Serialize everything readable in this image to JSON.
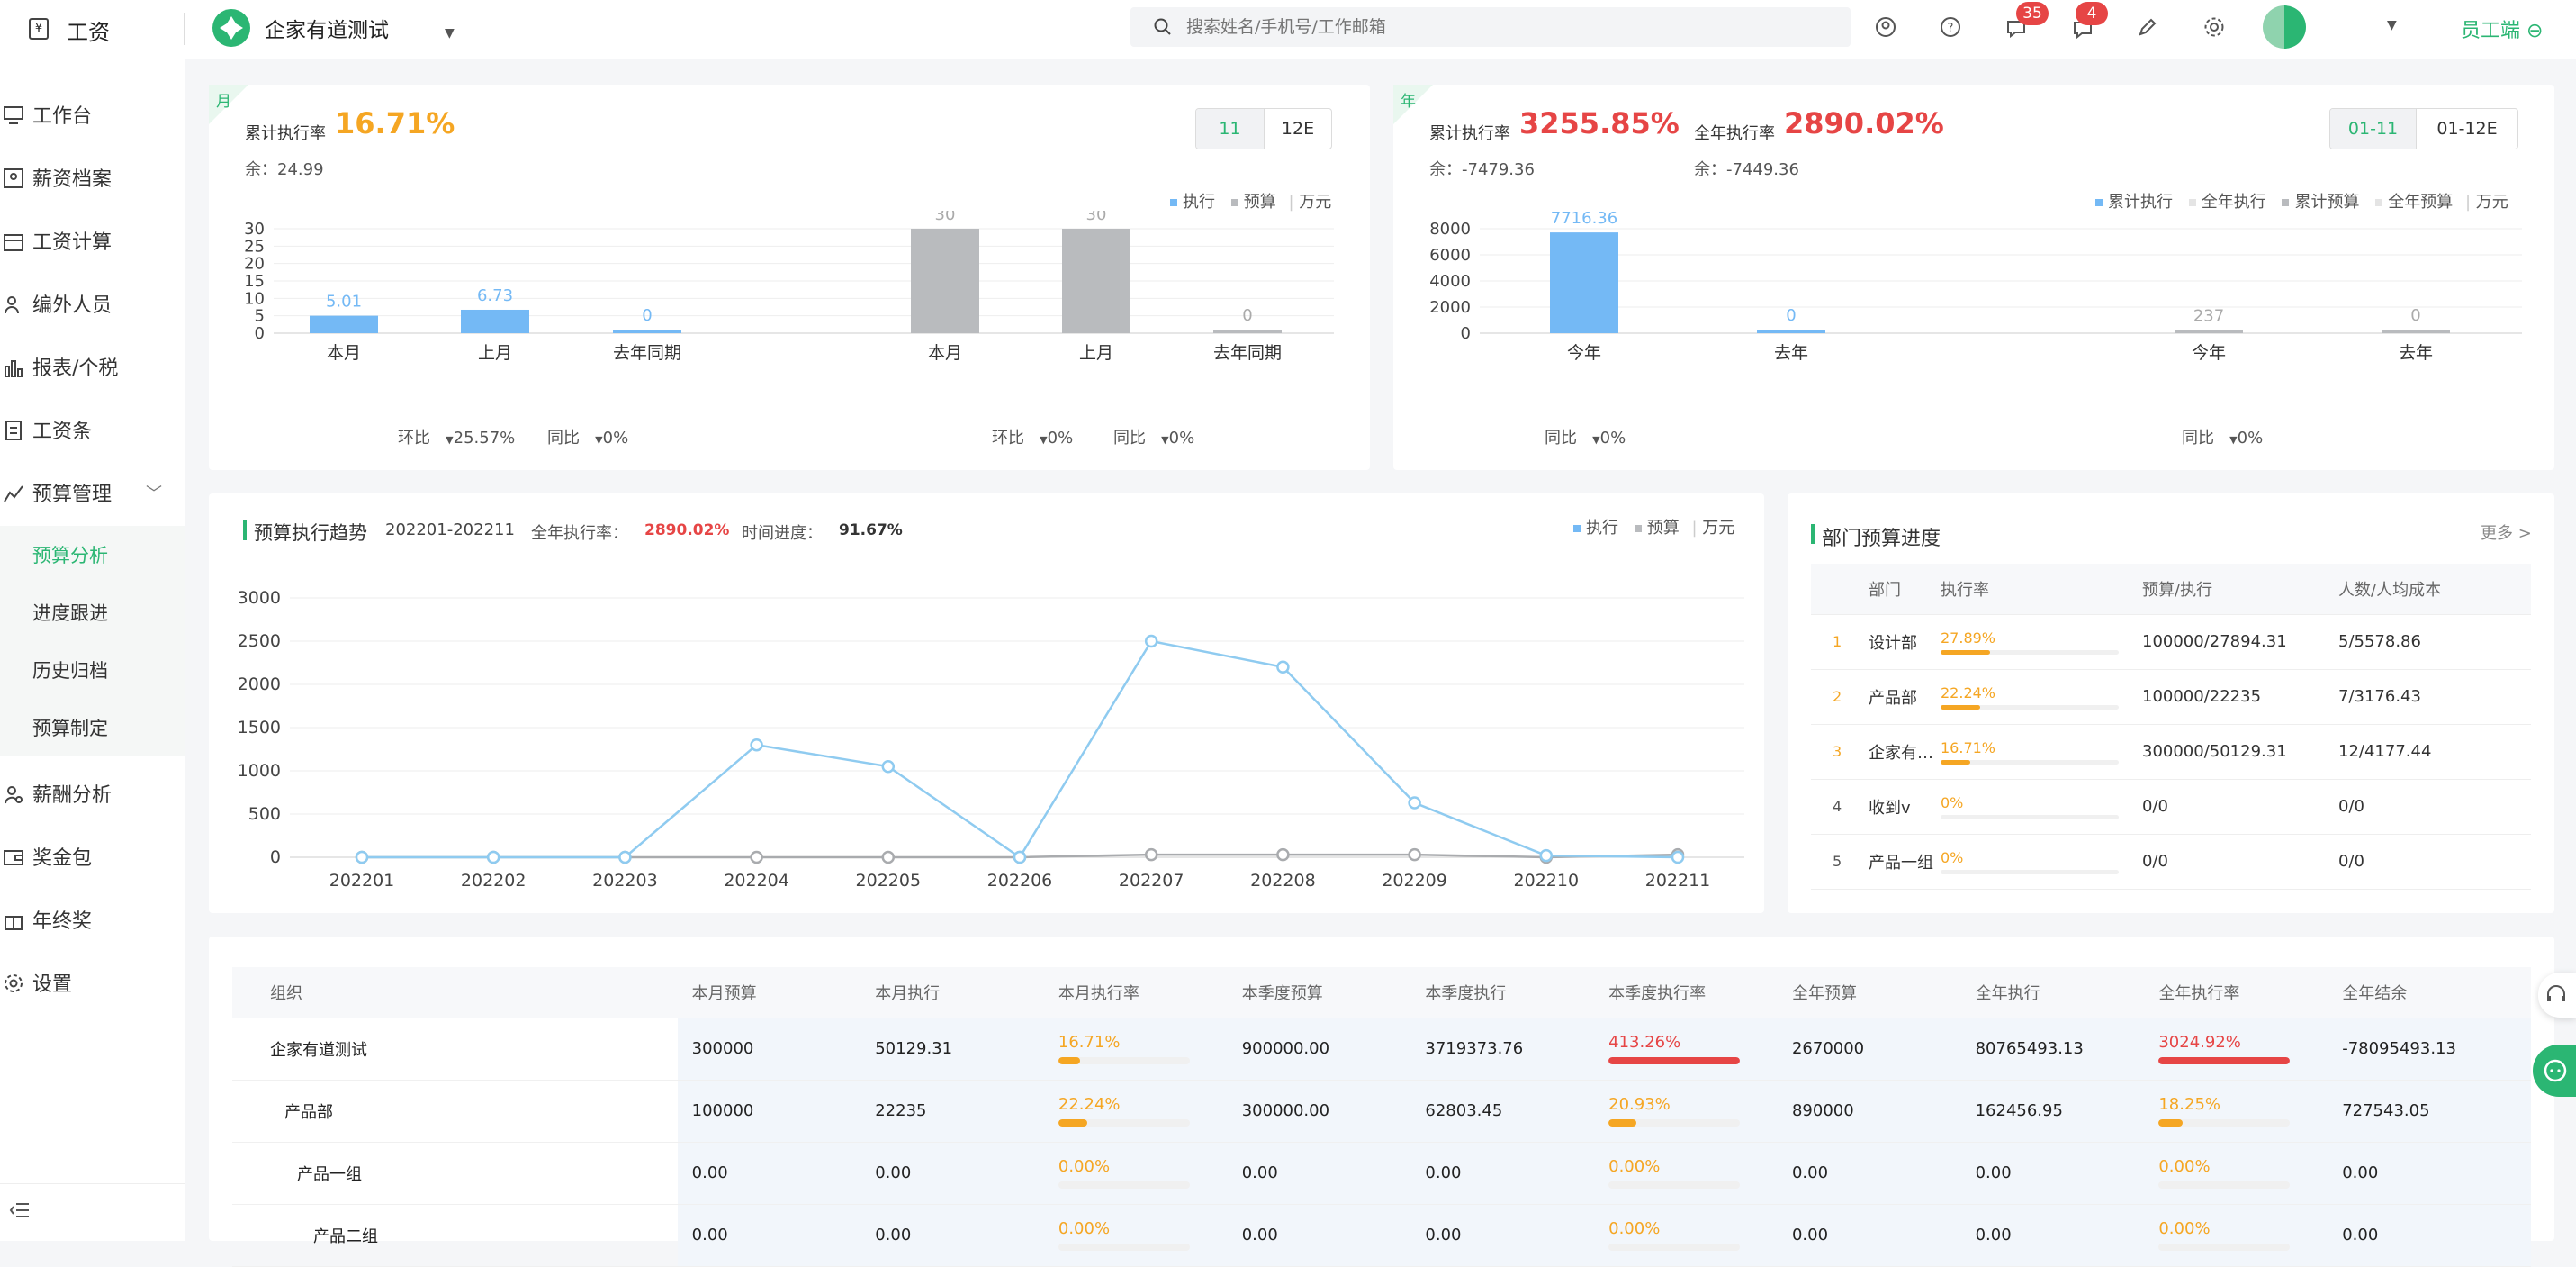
{
  "app": {
    "logo_text": "工资",
    "company": "企家有道测试",
    "search_placeholder": "搜索姓名/手机号/工作邮箱",
    "notif_count": "35",
    "msg_count": "4",
    "employee_side": "员工端"
  },
  "sidebar": {
    "items": [
      {
        "label": "工作台",
        "icon": "monitor-icon"
      },
      {
        "label": "薪资档案",
        "icon": "person-card-icon"
      },
      {
        "label": "工资计算",
        "icon": "calendar-icon"
      },
      {
        "label": "编外人员",
        "icon": "person-add-icon"
      },
      {
        "label": "报表/个税",
        "icon": "bar-chart-icon"
      },
      {
        "label": "工资条",
        "icon": "document-icon"
      },
      {
        "label": "预算管理",
        "icon": "trend-icon"
      },
      {
        "label": "预算分析"
      },
      {
        "label": "进度跟进"
      },
      {
        "label": "历史归档"
      },
      {
        "label": "预算制定"
      },
      {
        "label": "薪酬分析",
        "icon": "person-search-icon"
      },
      {
        "label": "奖金包",
        "icon": "wallet-icon"
      },
      {
        "label": "年终奖",
        "icon": "gift-icon"
      },
      {
        "label": "设置",
        "icon": "gear-icon"
      }
    ]
  },
  "month_card": {
    "tag": "月",
    "rate_label": "累计执行率",
    "rate": "16.71%",
    "remain": "余：24.99",
    "seg": [
      "11",
      "12E"
    ],
    "legend": {
      "exec": "执行",
      "budget": "预算",
      "unit": "万元"
    },
    "compare": {
      "hb_label": "环比",
      "hb_value": "25.57%",
      "tb_label": "同比",
      "tb_value": "0%",
      "hb2_label": "环比",
      "hb2_value": "0%",
      "tb2_label": "同比",
      "tb2_value": "0%"
    }
  },
  "year_card": {
    "tag": "年",
    "rate1_label": "累计执行率",
    "rate1": "3255.85%",
    "remain1": "余：-7479.36",
    "rate2_label": "全年执行率",
    "rate2": "2890.02%",
    "remain2": "余：-7449.36",
    "seg": [
      "01-11",
      "01-12E"
    ],
    "legend": {
      "l1": "累计执行",
      "l2": "全年执行",
      "l3": "累计预算",
      "l4": "全年预算",
      "unit": "万元"
    },
    "compare": {
      "tb_label": "同比",
      "tb_value": "0%",
      "tb2_label": "同比",
      "tb2_value": "0%"
    }
  },
  "trend_card": {
    "title": "预算执行趋势",
    "range": "202201-202211",
    "rate_label": "全年执行率：",
    "rate": "2890.02%",
    "progress_label": "时间进度：",
    "progress": "91.67%",
    "legend": {
      "exec": "执行",
      "budget": "预算",
      "unit": "万元"
    }
  },
  "dept_card": {
    "title": "部门预算进度",
    "more": "更多 >",
    "headers": [
      "部门",
      "执行率",
      "预算/执行",
      "人数/人均成本"
    ],
    "rows": [
      {
        "idx": "1",
        "name": "设计部",
        "rate": "27.89%",
        "fill": 0.2789,
        "budget": "100000/27894.31",
        "people": "5/5578.86"
      },
      {
        "idx": "2",
        "name": "产品部",
        "rate": "22.24%",
        "fill": 0.2224,
        "budget": "100000/22235",
        "people": "7/3176.43"
      },
      {
        "idx": "3",
        "name": "企家有…",
        "rate": "16.71%",
        "fill": 0.1671,
        "budget": "300000/50129.31",
        "people": "12/4177.44"
      },
      {
        "idx": "4",
        "name": "收到v",
        "rate": "0%",
        "fill": 0.0,
        "budget": "0/0",
        "people": "0/0"
      },
      {
        "idx": "5",
        "name": "产品一组",
        "rate": "0%",
        "fill": 0.0,
        "budget": "0/0",
        "people": "0/0"
      }
    ]
  },
  "org_table": {
    "headers": [
      "组织",
      "本月预算",
      "本月执行",
      "本月执行率",
      "本季度预算",
      "本季度执行",
      "本季度执行率",
      "全年预算",
      "全年执行",
      "全年执行率",
      "全年结余"
    ],
    "rows": [
      {
        "org": "企家有道测试",
        "mb": "300000",
        "me": "50129.31",
        "mr": "16.71%",
        "mr_fill": 0.1671,
        "mr_color": "#f5a623",
        "qb": "900000.00",
        "qe": "3719373.76",
        "qr": "413.26%",
        "qr_fill": 1.0,
        "qr_color": "#e64545",
        "yb": "2670000",
        "ye": "80765493.13",
        "yr": "3024.92%",
        "yr_fill": 1.0,
        "yr_color": "#e64545",
        "ys": "-78095493.13"
      },
      {
        "org": "产品部",
        "mb": "100000",
        "me": "22235",
        "mr": "22.24%",
        "mr_fill": 0.2224,
        "mr_color": "#f5a623",
        "qb": "300000.00",
        "qe": "62803.45",
        "qr": "20.93%",
        "qr_fill": 0.2093,
        "qr_color": "#f5a623",
        "yb": "890000",
        "ye": "162456.95",
        "yr": "18.25%",
        "yr_fill": 0.1825,
        "yr_color": "#f5a623",
        "ys": "727543.05"
      },
      {
        "org": "产品一组",
        "mb": "0.00",
        "me": "0.00",
        "mr": "0.00%",
        "mr_fill": 0.0,
        "mr_color": "#f5a623",
        "qb": "0.00",
        "qe": "0.00",
        "qr": "0.00%",
        "qr_fill": 0.0,
        "qr_color": "#f5a623",
        "yb": "0.00",
        "ye": "0.00",
        "yr": "0.00%",
        "yr_fill": 0.0,
        "yr_color": "#f5a623",
        "ys": "0.00"
      },
      {
        "org": "产品二组",
        "mb": "0.00",
        "me": "0.00",
        "mr": "0.00%",
        "mr_fill": 0.0,
        "mr_color": "#f5a623",
        "qb": "0.00",
        "qe": "0.00",
        "qr": "0.00%",
        "qr_fill": 0.0,
        "qr_color": "#f5a623",
        "yb": "0.00",
        "ye": "0.00",
        "yr": "0.00%",
        "yr_fill": 0.0,
        "yr_color": "#f5a623",
        "ys": "0.00"
      }
    ]
  },
  "chart_data": [
    {
      "type": "bar",
      "name": "month-exec",
      "categories": [
        "本月",
        "上月",
        "去年同期"
      ],
      "values": [
        5.01,
        6.73,
        0
      ],
      "ylim": [
        0,
        30
      ],
      "yticks": [
        0,
        5,
        10,
        15,
        20,
        25,
        30
      ],
      "color": "#74b9f5"
    },
    {
      "type": "bar",
      "name": "month-budget",
      "categories": [
        "本月",
        "上月",
        "去年同期"
      ],
      "values": [
        30,
        30,
        0
      ],
      "ylim": [
        0,
        30
      ],
      "color": "#b9bbbe"
    },
    {
      "type": "bar",
      "name": "year-exec",
      "categories": [
        "今年",
        "去年"
      ],
      "values": [
        7716.36,
        0
      ],
      "ylim": [
        0,
        8000
      ],
      "yticks": [
        0,
        2000,
        4000,
        6000,
        8000
      ],
      "color": "#74b9f5"
    },
    {
      "type": "bar",
      "name": "year-budget",
      "categories": [
        "今年",
        "去年"
      ],
      "values": [
        237,
        0
      ],
      "ylim": [
        0,
        8000
      ],
      "color": "#b9bbbe"
    },
    {
      "type": "line",
      "name": "trend",
      "x": [
        "202201",
        "202202",
        "202203",
        "202204",
        "202205",
        "202206",
        "202207",
        "202208",
        "202209",
        "202210",
        "202211"
      ],
      "ylim": [
        0,
        3000
      ],
      "yticks": [
        0,
        500,
        1000,
        1500,
        2000,
        2500,
        3000
      ],
      "series": [
        {
          "name": "执行",
          "values": [
            0,
            0,
            0,
            1300,
            1050,
            0,
            2500,
            2200,
            630,
            20,
            0
          ],
          "color": "#8fcbf0"
        },
        {
          "name": "预算",
          "values": [
            0,
            0,
            0,
            0,
            0,
            0,
            30,
            30,
            30,
            0,
            30
          ],
          "color": "#a9abae"
        }
      ]
    }
  ]
}
